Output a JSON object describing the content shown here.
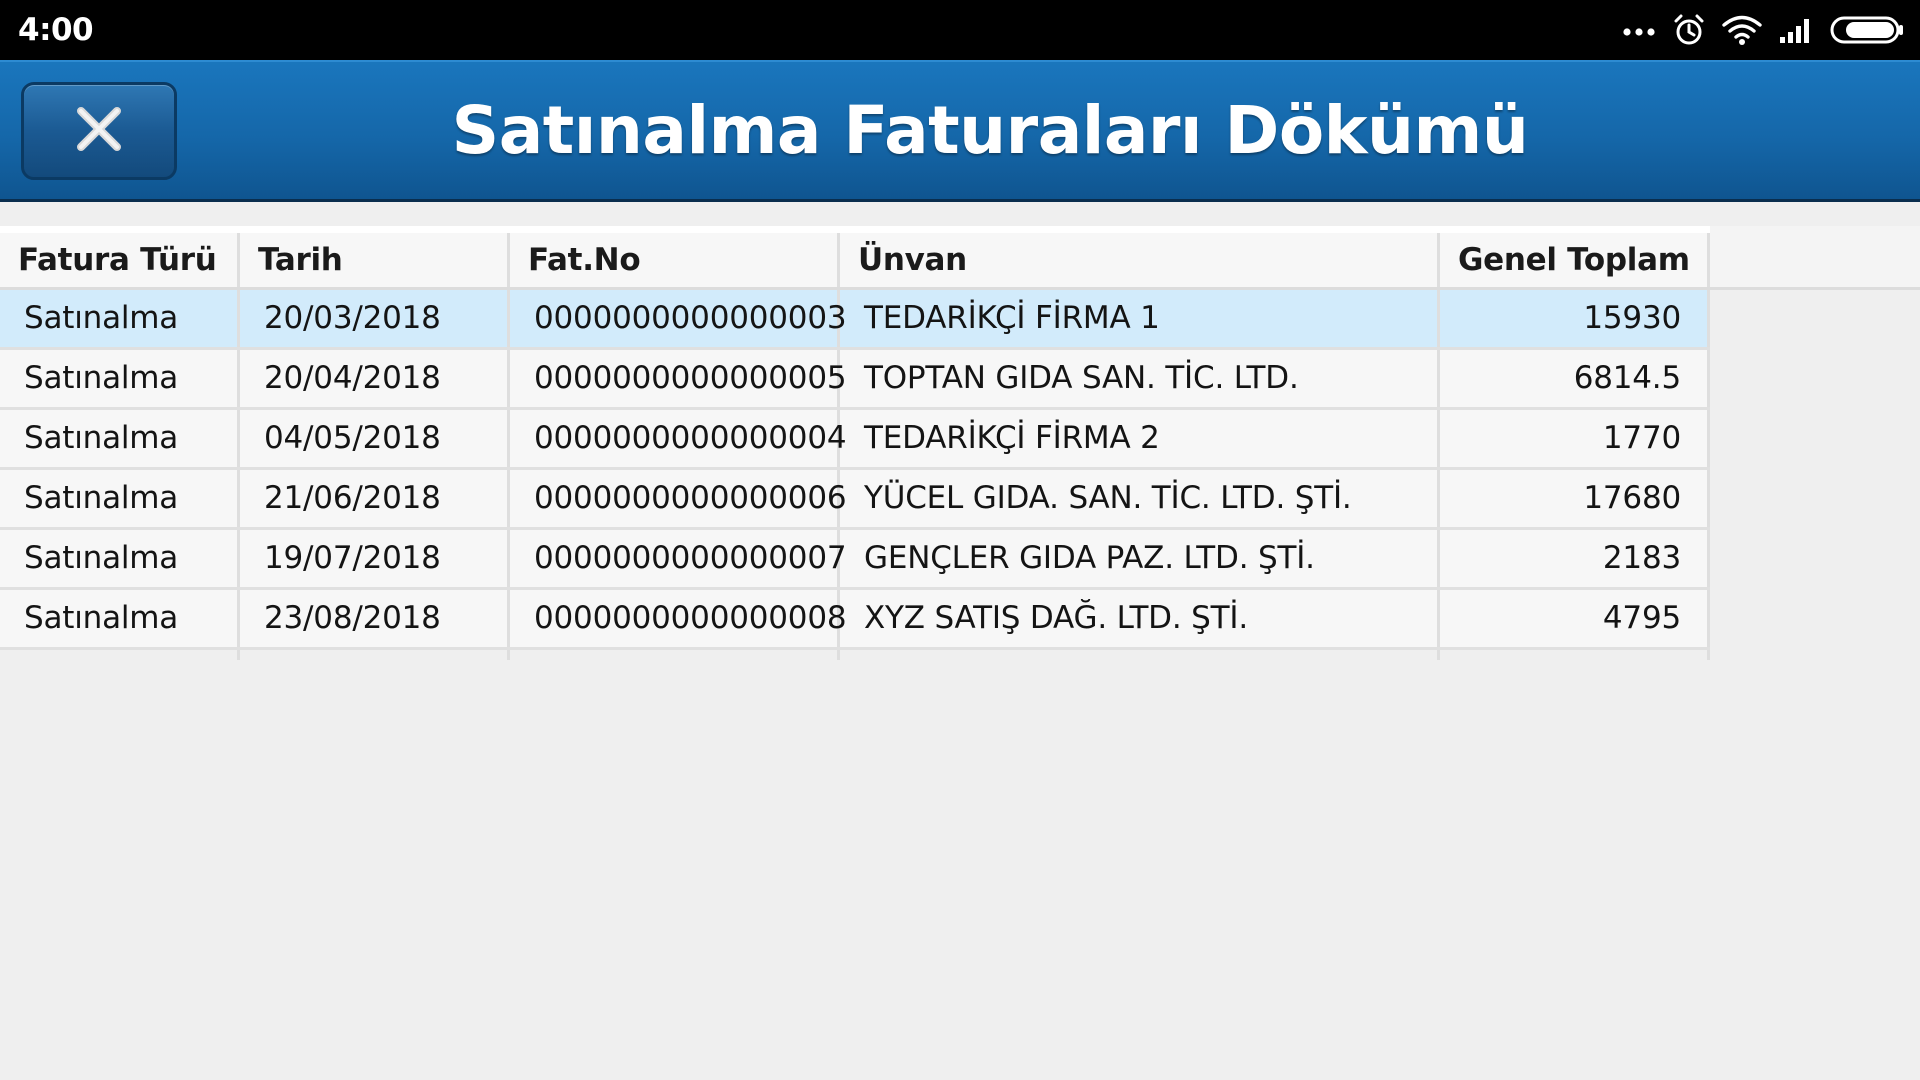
{
  "status_bar": {
    "time": "4:00",
    "icons": [
      "more-dots-icon",
      "alarm-icon",
      "wifi-icon",
      "signal-icon",
      "battery-icon"
    ]
  },
  "header": {
    "title": "Satınalma Faturaları Dökümü",
    "close_icon": "close-icon"
  },
  "table": {
    "columns": [
      "Fatura Türü",
      "Tarih",
      "Fat.No",
      "Ünvan",
      "Genel Toplam"
    ],
    "rows": [
      [
        "Satınalma",
        "20/03/2018",
        "0000000000000003",
        "TEDARİKÇİ FİRMA 1",
        "15930"
      ],
      [
        "Satınalma",
        "20/04/2018",
        "0000000000000005",
        "TOPTAN GIDA SAN. TİC. LTD.",
        "6814.5"
      ],
      [
        "Satınalma",
        "04/05/2018",
        "0000000000000004",
        "TEDARİKÇİ FİRMA 2",
        "1770"
      ],
      [
        "Satınalma",
        "21/06/2018",
        "0000000000000006",
        "YÜCEL GIDA. SAN. TİC. LTD. ŞTİ.",
        "17680"
      ],
      [
        "Satınalma",
        "19/07/2018",
        "0000000000000007",
        "GENÇLER GIDA PAZ. LTD. ŞTİ.",
        "2183"
      ],
      [
        "Satınalma",
        "23/08/2018",
        "0000000000000008",
        "XYZ SATIŞ DAĞ. LTD. ŞTİ.",
        "4795"
      ]
    ],
    "selected_row": 0
  },
  "colors": {
    "header_blue": "#1567a9",
    "selected_row": "#d2ebfb",
    "status_bar": "#000000"
  }
}
